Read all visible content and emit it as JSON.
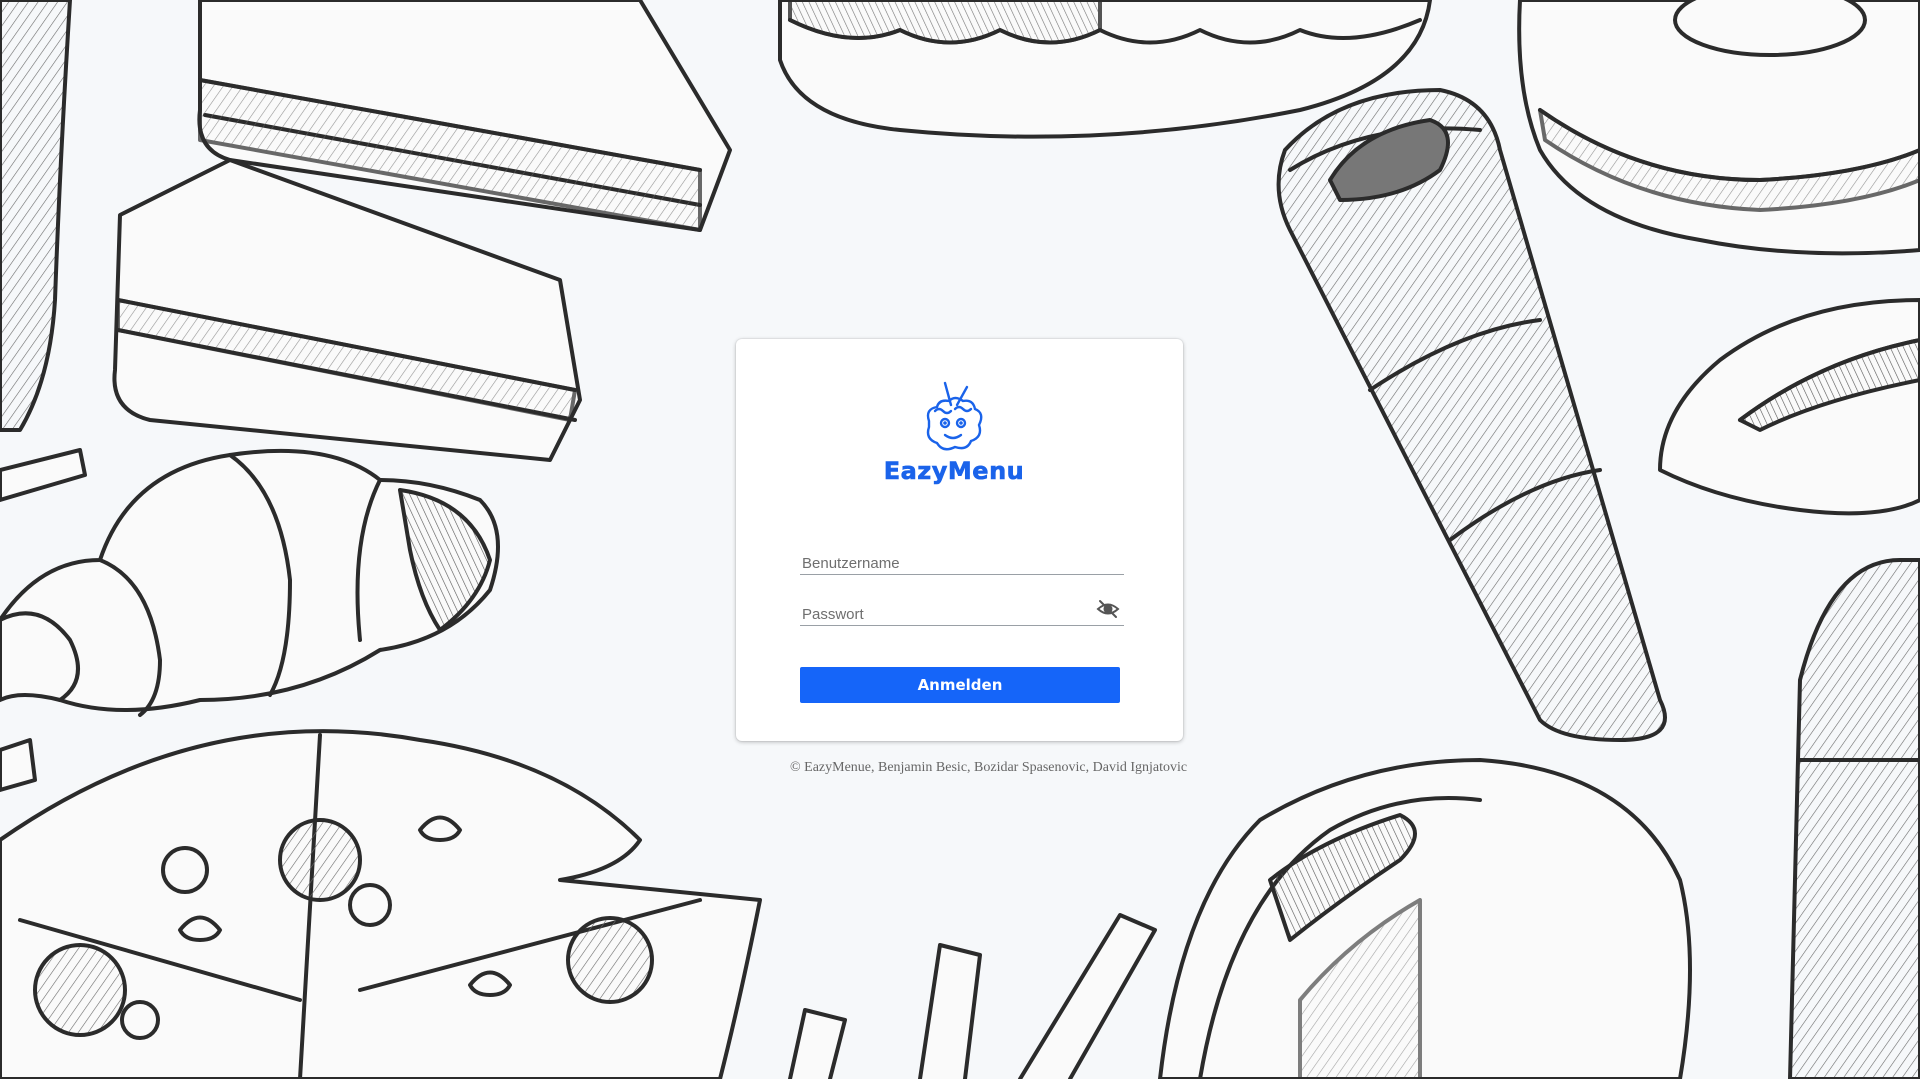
{
  "brand": {
    "name": "EazyMenu",
    "color": "#1a63ea"
  },
  "login": {
    "username_placeholder": "Benutzername",
    "username_value": "",
    "password_placeholder": "Passwort",
    "password_value": "",
    "submit_label": "Anmelden",
    "button_color": "#1565f9"
  },
  "footer": {
    "text": "© EazyMenue, Benjamin Besic, Bozidar Spasenovic, David Ignjatovic"
  },
  "icons": {
    "logo": "mascot-logo-icon",
    "password_toggle": "eye-off-icon"
  }
}
